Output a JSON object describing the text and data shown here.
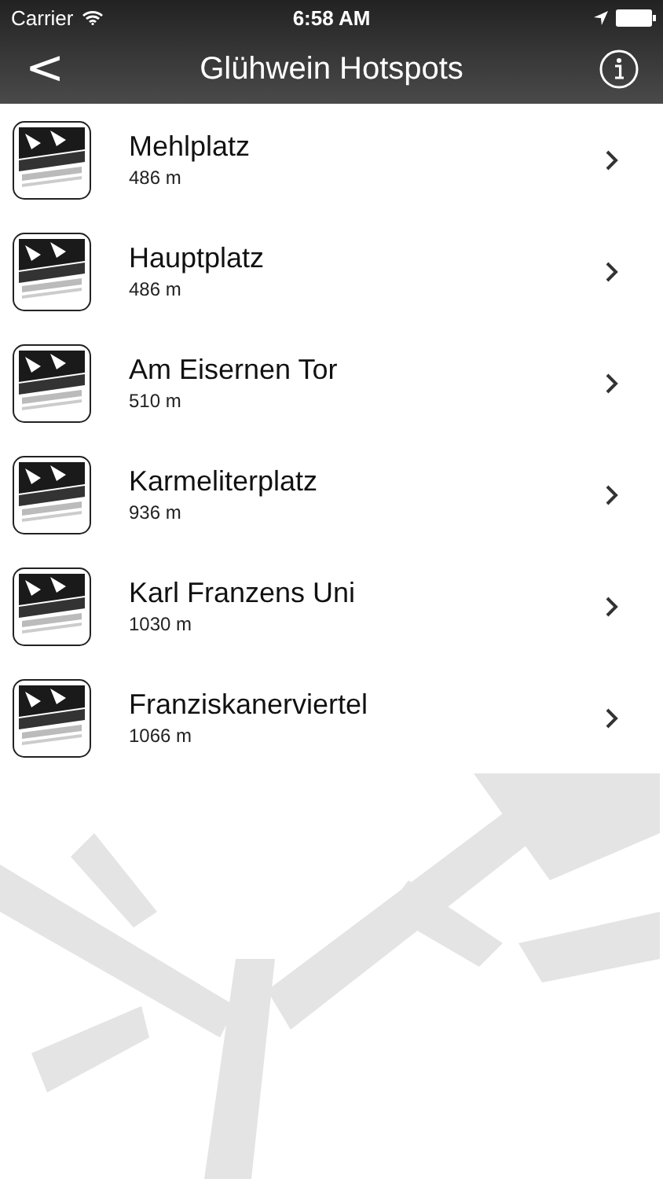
{
  "status_bar": {
    "carrier": "Carrier",
    "time": "6:58 AM"
  },
  "nav_bar": {
    "back": "<",
    "title": "Glühwein Hotspots"
  },
  "rows": [
    {
      "name": "Mehlplatz",
      "distance": "486 m"
    },
    {
      "name": "Hauptplatz",
      "distance": "486 m"
    },
    {
      "name": "Am Eisernen Tor",
      "distance": "510 m"
    },
    {
      "name": "Karmeliterplatz",
      "distance": "936 m"
    },
    {
      "name": "Karl Franzens Uni",
      "distance": "1030 m"
    },
    {
      "name": "Franziskanerviertel",
      "distance": "1066 m"
    }
  ]
}
